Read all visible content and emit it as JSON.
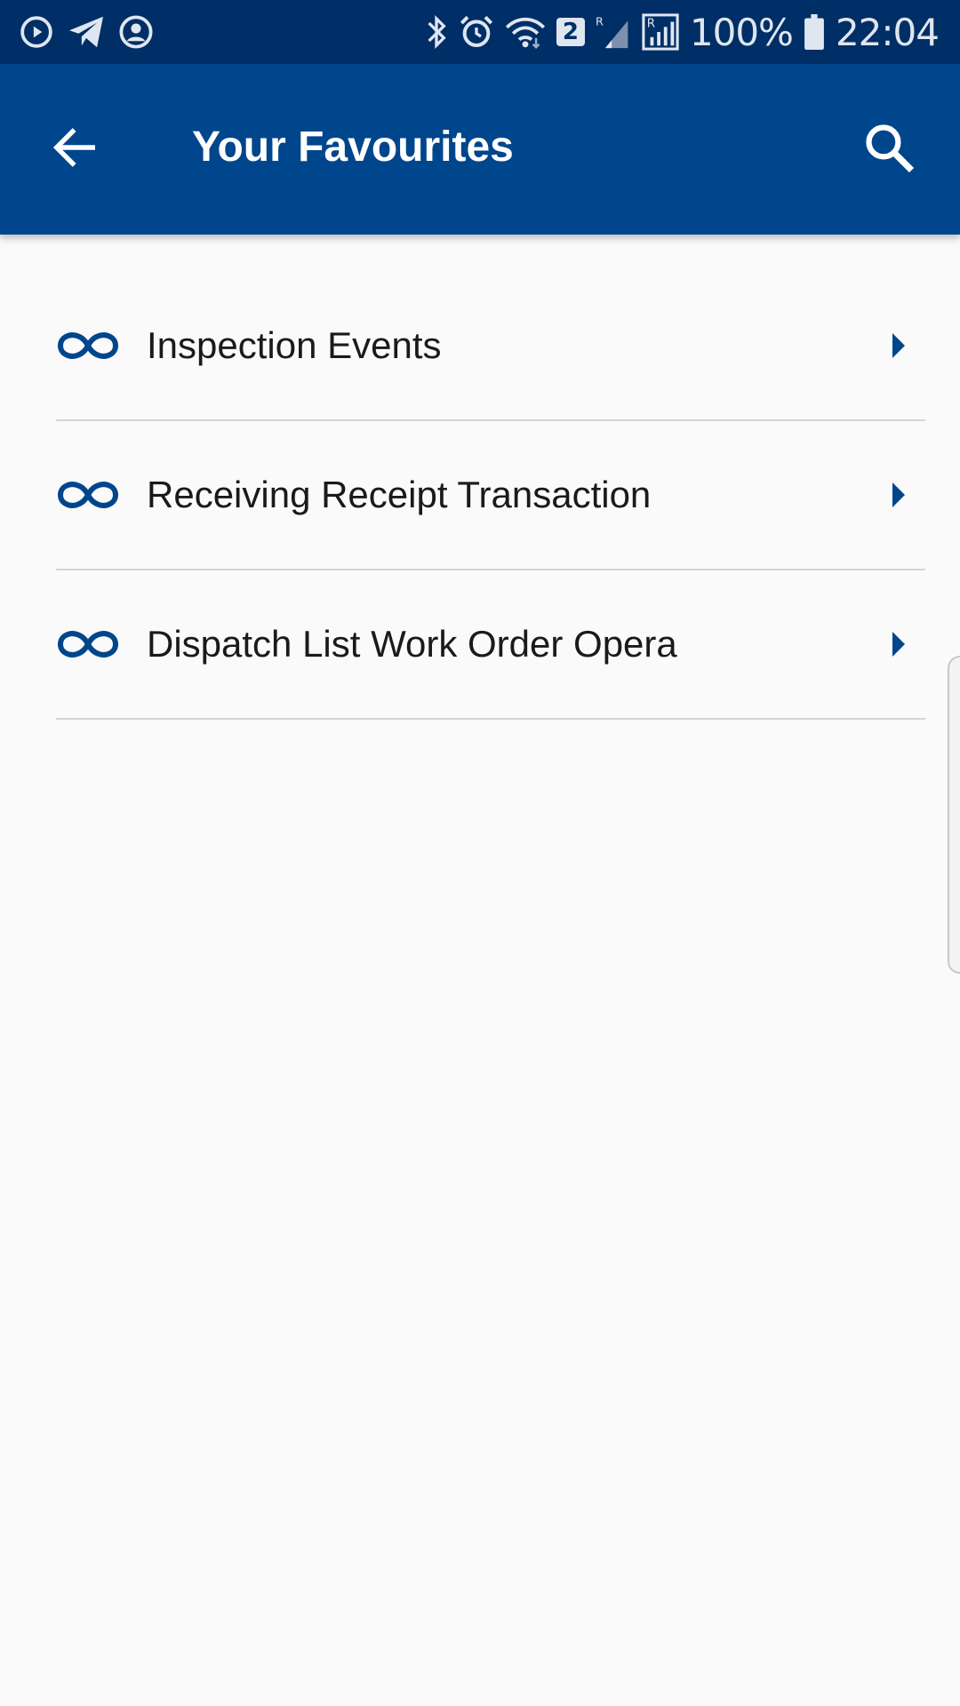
{
  "status_bar": {
    "battery": "100%",
    "time": "22:04",
    "sim_badge": "2",
    "icons": [
      "play-circle-icon",
      "telegram-icon",
      "account-circle-icon",
      "bluetooth-icon",
      "alarm-icon",
      "wifi-icon",
      "signal-icon",
      "signal-roaming-icon",
      "battery-icon"
    ]
  },
  "app_bar": {
    "title": "Your Favourites",
    "back_icon": "arrow-back-icon",
    "search_icon": "search-icon"
  },
  "favourites": [
    {
      "label": "Inspection Events",
      "icon": "infinity-icon"
    },
    {
      "label": "Receiving Receipt Transaction",
      "icon": "infinity-icon"
    },
    {
      "label": "Dispatch List Work Order Opera",
      "icon": "infinity-icon"
    }
  ],
  "colors": {
    "status_bar": "#002e66",
    "app_bar": "#00468c",
    "accent": "#00468c",
    "background": "#fafafa",
    "divider": "#d4d4d4"
  }
}
